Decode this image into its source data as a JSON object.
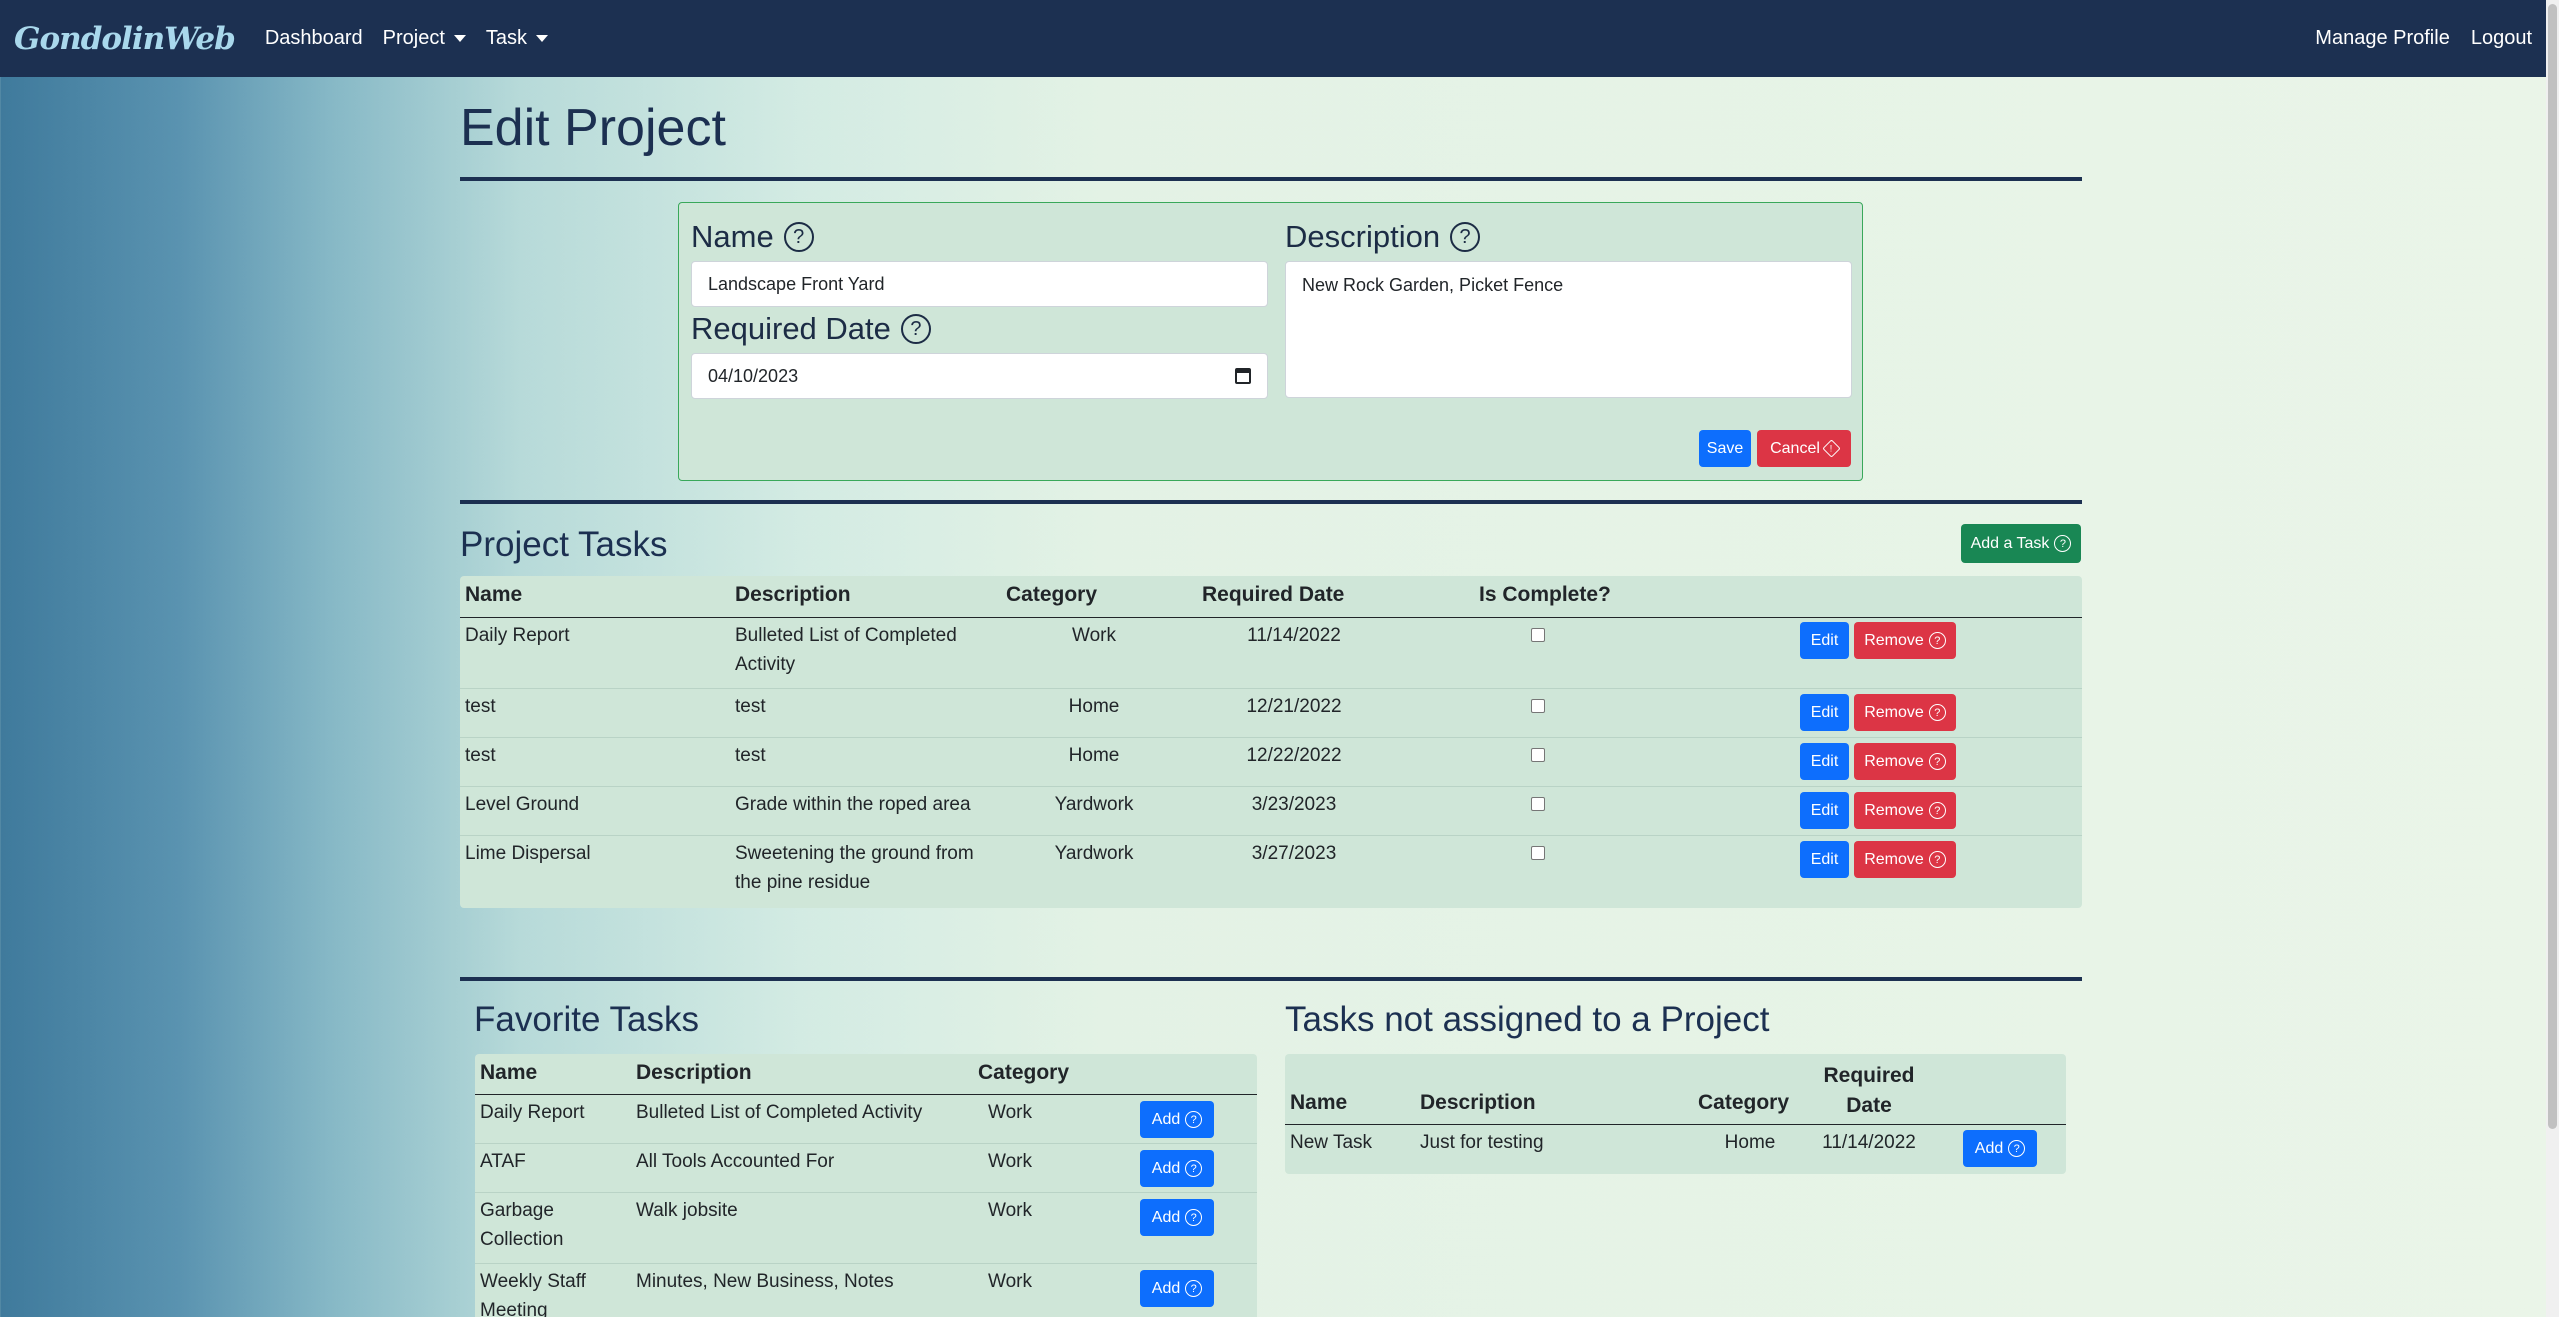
{
  "nav": {
    "brand": "GondolinWeb",
    "dashboard": "Dashboard",
    "project": "Project",
    "task": "Task",
    "manage_profile": "Manage Profile",
    "logout": "Logout"
  },
  "page": {
    "title": "Edit Project"
  },
  "form": {
    "name_label": "Name",
    "name_value": "Landscape Front Yard",
    "description_label": "Description",
    "description_value": "New Rock Garden, Picket Fence",
    "required_date_label": "Required Date",
    "required_date_value": "04/10/2023",
    "save_label": "Save",
    "cancel_label": "Cancel"
  },
  "project_tasks": {
    "title": "Project Tasks",
    "add_label": "Add a Task",
    "columns": [
      "Name",
      "Description",
      "Category",
      "Required Date",
      "Is Complete?"
    ],
    "edit_label": "Edit",
    "remove_label": "Remove",
    "rows": [
      {
        "name": "Daily Report",
        "description": "Bulleted List of Completed Activity",
        "category": "Work",
        "date": "11/14/2022",
        "complete": false
      },
      {
        "name": "test",
        "description": "test",
        "category": "Home",
        "date": "12/21/2022",
        "complete": false
      },
      {
        "name": "test",
        "description": "test",
        "category": "Home",
        "date": "12/22/2022",
        "complete": false
      },
      {
        "name": "Level Ground",
        "description": "Grade within the roped area",
        "category": "Yardwork",
        "date": "3/23/2023",
        "complete": false
      },
      {
        "name": "Lime Dispersal",
        "description": "Sweetening the ground from the pine residue",
        "category": "Yardwork",
        "date": "3/27/2023",
        "complete": false
      }
    ]
  },
  "favorite_tasks": {
    "title": "Favorite Tasks",
    "columns": [
      "Name",
      "Description",
      "Category"
    ],
    "add_label": "Add",
    "rows": [
      {
        "name": "Daily Report",
        "description": "Bulleted List of Completed Activity",
        "category": "Work"
      },
      {
        "name": "ATAF",
        "description": "All Tools Accounted For",
        "category": "Work"
      },
      {
        "name": "Garbage Collection",
        "description": "Walk jobsite",
        "category": "Work"
      },
      {
        "name": "Weekly Staff Meeting",
        "description": "Minutes, New Business, Notes",
        "category": "Work"
      }
    ]
  },
  "unassigned_tasks": {
    "title": "Tasks not assigned to a Project",
    "columns": [
      "Name",
      "Description",
      "Category",
      "Required Date"
    ],
    "add_label": "Add",
    "rows": [
      {
        "name": "New Task",
        "description": "Just for testing",
        "category": "Home",
        "date": "11/14/2022"
      }
    ]
  },
  "colors": {
    "navbar": "#1c3051",
    "primary": "#0d6efd",
    "danger": "#dc3545",
    "success": "#198754",
    "panel": "#cfe6d8"
  }
}
